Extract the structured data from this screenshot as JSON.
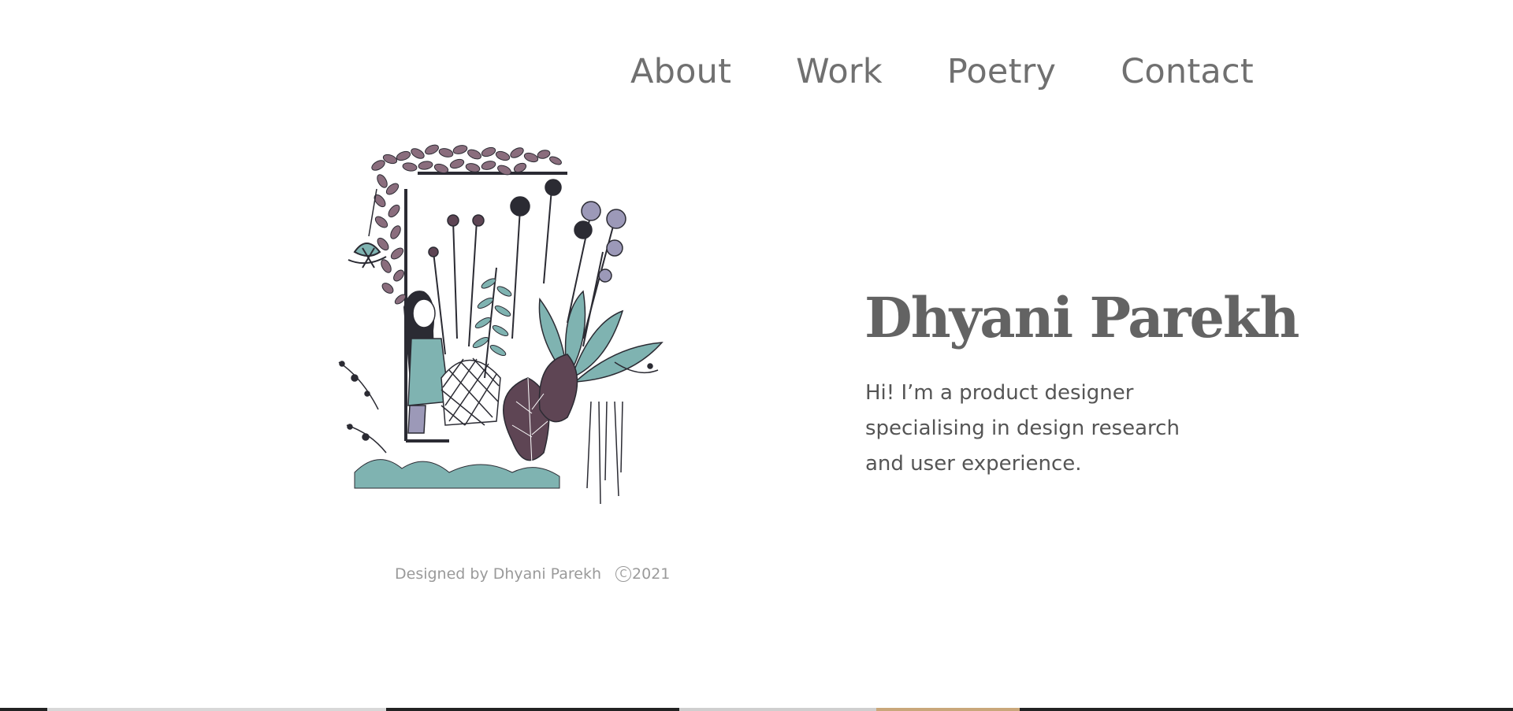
{
  "nav": {
    "items": [
      {
        "label": "About"
      },
      {
        "label": "Work"
      },
      {
        "label": "Poetry"
      },
      {
        "label": "Contact"
      }
    ]
  },
  "hero": {
    "name": "Dhyani Parekh",
    "intro_lines": [
      "Hi! I’m a product designer",
      "specialising in design research",
      "and user experience."
    ]
  },
  "footer": {
    "credit": "Designed by Dhyani Parekh",
    "copyright_icon": "copyright-icon",
    "year": "2021"
  },
  "illustration": {
    "icon": "garden-illustration",
    "colors": {
      "ink": "#2b2b33",
      "plum": "#5e4554",
      "mauve": "#8a6d7d",
      "teal": "#7fb3b1",
      "lavender": "#9c99b8"
    }
  },
  "colors": {
    "nav_text": "#707070",
    "name_text": "#636363",
    "body_text": "#555555",
    "credit_text": "#9a9a9a",
    "background": "#ffffff"
  }
}
